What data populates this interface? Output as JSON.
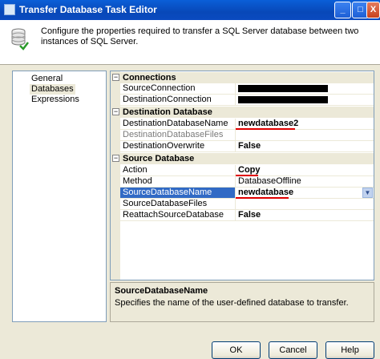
{
  "window": {
    "title": "Transfer Database Task Editor",
    "controls": [
      "_",
      "□",
      "X"
    ]
  },
  "header": {
    "description": "Configure the properties required to transfer a SQL Server database between two instances of SQL Server.",
    "icon": "database-transfer-icon"
  },
  "nav": {
    "items": [
      {
        "label": "General",
        "selected": false
      },
      {
        "label": "Databases",
        "selected": true
      },
      {
        "label": "Expressions",
        "selected": false
      }
    ]
  },
  "grid": {
    "categories": [
      {
        "label": "Connections",
        "toggle": "−",
        "properties": [
          {
            "name": "SourceConnection",
            "value": "",
            "redacted": true
          },
          {
            "name": "DestinationConnection",
            "value": "",
            "redacted": true
          }
        ]
      },
      {
        "label": "Destination Database",
        "toggle": "−",
        "properties": [
          {
            "name": "DestinationDatabaseName",
            "value": "newdatabase2"
          },
          {
            "name": "DestinationDatabaseFiles",
            "value": ""
          },
          {
            "name": "DestinationOverwrite",
            "value": "False"
          }
        ]
      },
      {
        "label": "Source Database",
        "toggle": "−",
        "properties": [
          {
            "name": "Action",
            "value": "Copy"
          },
          {
            "name": "Method",
            "value": "DatabaseOffline"
          },
          {
            "name": "SourceDatabaseName",
            "value": "newdatabase",
            "selected": true
          },
          {
            "name": "SourceDatabaseFiles",
            "value": ""
          },
          {
            "name": "ReattachSourceDatabase",
            "value": "False"
          }
        ]
      }
    ]
  },
  "description_panel": {
    "title": "SourceDatabaseName",
    "text": "Specifies the name of the user-defined database to transfer."
  },
  "buttons": {
    "ok": "OK",
    "cancel": "Cancel",
    "help": "Help"
  },
  "colors": {
    "selection": "#316ac5",
    "annotation": "#e00000",
    "titlebar": "#0a5fd8"
  }
}
